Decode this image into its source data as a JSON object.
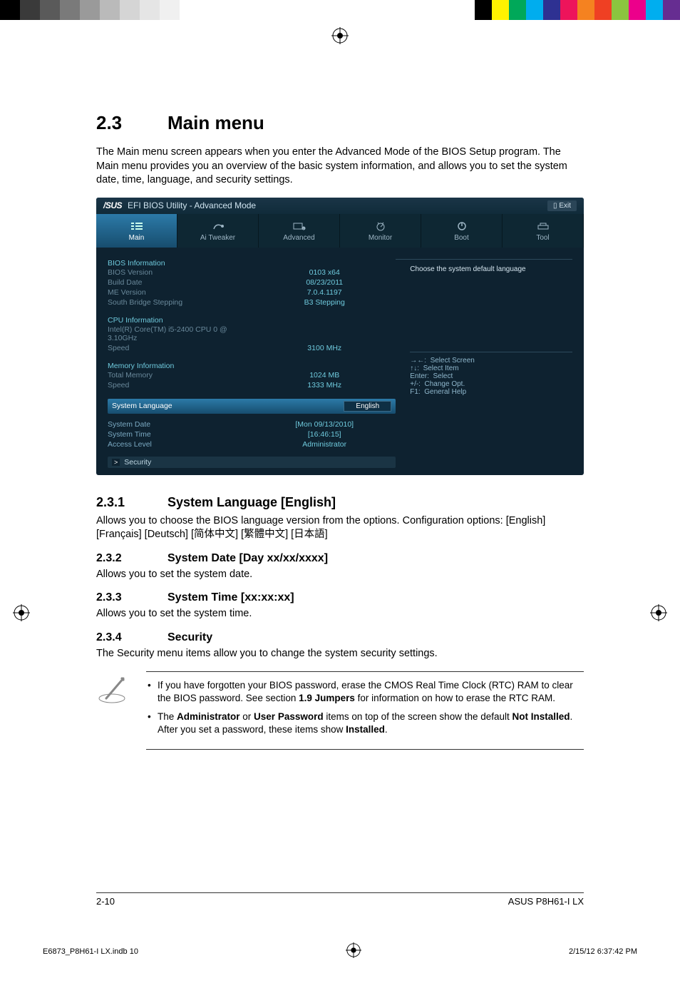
{
  "colorbar_left": [
    "#000",
    "#3a3a3a",
    "#5a5a5a",
    "#7a7a7a",
    "#9a9a9a",
    "#bababa",
    "#d5d5d5",
    "#e5e5e5",
    "#f0f0f0",
    "#ffffff"
  ],
  "colorbar_right": [
    "#000",
    "#fff200",
    "#00a859",
    "#00adee",
    "#2e3192",
    "#ed145b",
    "#f58220",
    "#ef4023",
    "#8bc53f",
    "#ec008b",
    "#00aeef",
    "#662d91"
  ],
  "section": {
    "number": "2.3",
    "title": "Main menu"
  },
  "intro": "The Main menu screen appears when you enter the Advanced Mode of the BIOS Setup program. The Main menu provides you an overview of the basic system information, and allows you to set the system date, time, language, and security settings.",
  "bios": {
    "brand": "/SUS",
    "title": "EFI BIOS Utility - Advanced Mode",
    "exit": "Exit",
    "tabs": [
      "Main",
      "Ai Tweaker",
      "Advanced",
      "Monitor",
      "Boot",
      "Tool"
    ],
    "right_help": "Choose the system default language",
    "groups": [
      {
        "head": "BIOS Information",
        "rows": [
          {
            "k": "BIOS Version",
            "v": "0103 x64"
          },
          {
            "k": "Build Date",
            "v": "08/23/2011"
          },
          {
            "k": "ME Version",
            "v": "7.0.4.1197"
          },
          {
            "k": "South Bridge Stepping",
            "v": "B3 Stepping"
          }
        ]
      },
      {
        "head": "CPU Information",
        "rows": [
          {
            "k": "Intel(R) Core(TM) i5-2400 CPU 0 @ 3.10GHz",
            "v": ""
          },
          {
            "k": "Speed",
            "v": "3100 MHz"
          }
        ]
      },
      {
        "head": "Memory Information",
        "rows": [
          {
            "k": "Total Memory",
            "v": "1024 MB"
          },
          {
            "k": "Speed",
            "v": "1333 MHz"
          }
        ]
      }
    ],
    "lang_label": "System Language",
    "lang_value": "English",
    "brackets": [
      {
        "k": "System Date",
        "v": "[Mon 09/13/2010]"
      },
      {
        "k": "System Time",
        "v": "[16:46:15]"
      },
      {
        "k": "Access Level",
        "v": "Administrator"
      }
    ],
    "security": "Security",
    "keyhelp": "→←:  Select Screen\n↑↓:  Select Item\nEnter:  Select\n+/-:  Change Opt.\nF1:  General Help"
  },
  "sub": [
    {
      "num": "2.3.1",
      "title": "System Language [English]",
      "body": "Allows you to choose the BIOS language version from the options. Configuration options: [English] [Français] [Deutsch] [简体中文] [繁體中文] [日本語]"
    },
    {
      "num": "2.3.2",
      "title": "System Date [Day xx/xx/xxxx]",
      "body": "Allows you to set the system date."
    },
    {
      "num": "2.3.3",
      "title": "System Time [xx:xx:xx]",
      "body": "Allows you to set the system time."
    },
    {
      "num": "2.3.4",
      "title": "Security",
      "body": "The Security menu items allow you to change the system security settings."
    }
  ],
  "notes": [
    {
      "pre": "If you have forgotten your BIOS password, erase the CMOS Real Time Clock (RTC) RAM to clear the BIOS password. See section ",
      "b1": "1.9 Jumpers",
      "post": " for information on how to erase the RTC RAM."
    },
    {
      "pre": "The ",
      "b1": "Administrator",
      "mid": " or ",
      "b2": "User Password",
      "mid2": " items on top of the screen show the default ",
      "b3": "Not Installed",
      "mid3": ". After you set a password, these items show ",
      "b4": "Installed",
      "post": "."
    }
  ],
  "footer": {
    "page": "2-10",
    "model": "ASUS P8H61-I LX"
  },
  "printfoot": {
    "file": "E6873_P8H61-I LX.indb   10",
    "date": "2/15/12   6:37:42 PM"
  }
}
